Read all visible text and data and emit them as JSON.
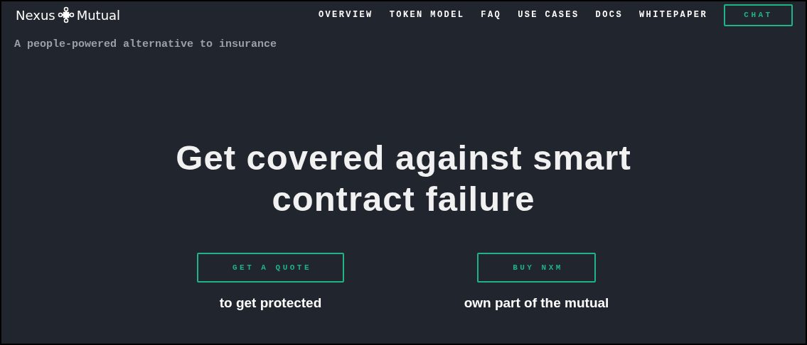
{
  "logo": {
    "left": "Nexus",
    "right": "Mutual"
  },
  "nav": {
    "links": [
      "OVERVIEW",
      "TOKEN MODEL",
      "FAQ",
      "USE CASES",
      "DOCS",
      "WHITEPAPER"
    ],
    "button": "CHAT"
  },
  "tagline": "A people-powered alternative to insurance",
  "hero": {
    "headline": "Get covered against smart contract failure",
    "actions": [
      {
        "button": "GET A QUOTE",
        "caption": "to get protected"
      },
      {
        "button": "BUY NXM",
        "caption": "own part of the mutual"
      }
    ]
  }
}
